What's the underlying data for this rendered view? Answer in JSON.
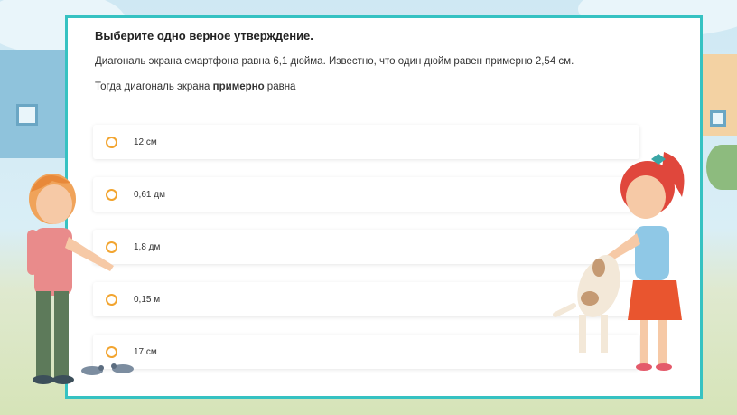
{
  "question": {
    "title": "Выберите одно верное утверждение.",
    "line1": "Диагональ экрана смартфона равна 6,1 дюйма. Известно, что один дюйм равен примерно 2,54 см.",
    "line2_prefix": "Тогда диагональ экрана ",
    "line2_bold": "примерно",
    "line2_suffix": " равна"
  },
  "options": [
    {
      "label": "12 см"
    },
    {
      "label": "0,61 дм"
    },
    {
      "label": "1,8 дм"
    },
    {
      "label": "0,15 м"
    },
    {
      "label": "17 см"
    }
  ],
  "colors": {
    "accent_border": "#36c2c2",
    "radio": "#f2a531"
  }
}
